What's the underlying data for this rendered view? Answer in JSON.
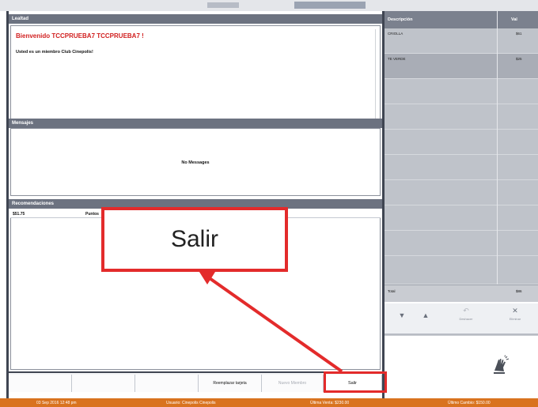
{
  "tabs": {
    "welcome": "Lealtad",
    "messages": "Mensajes",
    "recommendations": "Recomendaciones"
  },
  "welcome": {
    "title": "Bienvenido TCCPRUEBA7 TCCPRUEBA7 !",
    "subtitle": "Usted es un miembro Club Cinepolis!"
  },
  "messages": {
    "empty_text": "No Messages"
  },
  "recommendations": {
    "value": "$51.75",
    "label": "Puntos"
  },
  "bottom_bar": {
    "reemplazar_label": "Reemplazar tarjeta",
    "nuevo_label": "Nuevo Miembro",
    "salir_label": "Salir"
  },
  "order_grid": {
    "columns": [
      "Descripción",
      "Val"
    ],
    "rows": [
      {
        "description": "CRIOLLA",
        "value": "$61"
      },
      {
        "description": "TE VERDE",
        "value": "$25"
      }
    ],
    "total_label": "Total",
    "total_value": "$86"
  },
  "right_buttons": {
    "down": "▼",
    "up": "▲",
    "undo_label": "Deshacer",
    "delete_label": "Eliminar"
  },
  "status_bar": {
    "date": "03 Sep 2016 12:48 pm",
    "user": "Usuario: Cinepolis Cinepolis",
    "last_sale": "Última Venta: $230.00",
    "last_change": "Último Cambio: $150.00"
  },
  "callout": {
    "text": "Salir"
  },
  "colors": {
    "accent_red": "#e32b2b",
    "status_orange": "#d9731f",
    "title_red": "#d11f1f"
  }
}
